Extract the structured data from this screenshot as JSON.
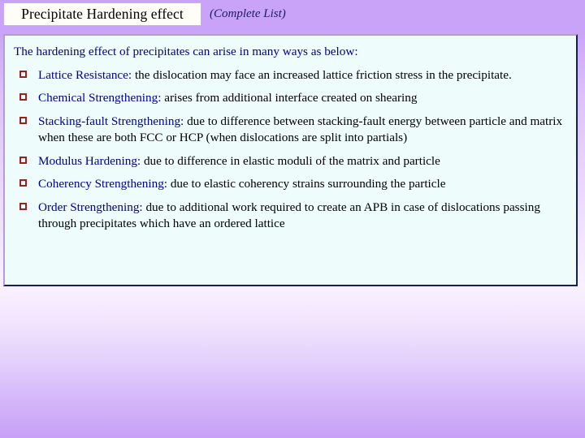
{
  "header": {
    "title": "Precipitate Hardening effect",
    "subtitle": "(Complete List)"
  },
  "content": {
    "intro": "The hardening effect of precipitates can arise in many ways as below:",
    "bullet_marker": "hollow-red-square",
    "items": [
      {
        "term": "Lattice Resistance",
        "separator": ":",
        "description": " the dislocation may face an increased lattice friction stress in the precipitate."
      },
      {
        "term": "Chemical Strengthening",
        "separator": ":",
        "description": " arises from additional interface created on shearing"
      },
      {
        "term": "Stacking-fault Strengthening",
        "separator": ":",
        "description": " due to difference between stacking-fault energy between particle and matrix when these are both FCC or HCP (when dislocations are split into partials)"
      },
      {
        "term": "Modulus Hardening",
        "separator": ":",
        "description": "  due to difference in elastic moduli of the matrix and particle"
      },
      {
        "term": "Coherency Strengthening",
        "separator": ":",
        "description": " due to elastic coherency strains surrounding the particle"
      },
      {
        "term": "Order Strengthening",
        "separator": ":",
        "description": " due to additional work required to create an APB in case of dislocations passing through precipitates which have an ordered lattice"
      }
    ]
  },
  "colors": {
    "header_band": "#c9a3f7",
    "title_box_fill": "#fffdf7",
    "title_box_border": "#cfa8f3",
    "content_fill": "#eefcfb",
    "content_border": "#1a1a5e",
    "term_text": "#00008f",
    "body_text": "#000000",
    "bullet": "#9e1f1f",
    "subtitle_text": "#1d1a63"
  }
}
